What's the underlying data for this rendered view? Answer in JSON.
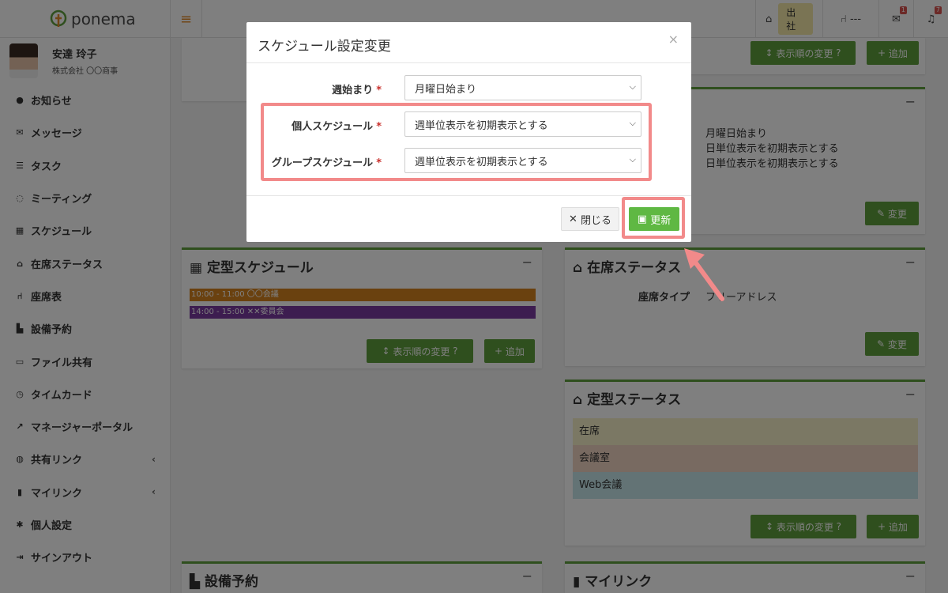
{
  "app": {
    "name": "ponema"
  },
  "header": {
    "status_label": "出社",
    "seat_label": "---",
    "message_count": "1",
    "notification_count": "7"
  },
  "user": {
    "name": "安達 玲子",
    "company": "株式会社 〇〇商事"
  },
  "sidebar": {
    "items": [
      {
        "label": "お知らせ",
        "icon": "info-icon"
      },
      {
        "label": "メッセージ",
        "icon": "envelope-icon"
      },
      {
        "label": "タスク",
        "icon": "list-icon"
      },
      {
        "label": "ミーティング",
        "icon": "chat-icon"
      },
      {
        "label": "スケジュール",
        "icon": "calendar-icon"
      },
      {
        "label": "在席ステータス",
        "icon": "desk-user-icon"
      },
      {
        "label": "座席表",
        "icon": "seat-icon"
      },
      {
        "label": "設備予約",
        "icon": "door-icon"
      },
      {
        "label": "ファイル共有",
        "icon": "folder-icon"
      },
      {
        "label": "タイムカード",
        "icon": "clock-icon"
      },
      {
        "label": "マネージャーポータル",
        "icon": "chart-icon"
      },
      {
        "label": "共有リンク",
        "icon": "globe-icon"
      },
      {
        "label": "マイリンク",
        "icon": "bookmark-icon"
      },
      {
        "label": "個人設定",
        "icon": "gear-icon"
      },
      {
        "label": "サインアウト",
        "icon": "signout-icon"
      }
    ]
  },
  "panels": {
    "top_right": {
      "order_label": "表示順の変更",
      "add_label": "追加"
    },
    "schedule_settings": {
      "values": [
        "月曜日始まり",
        "日単位表示を初期表示とする",
        "日単位表示を初期表示とする"
      ],
      "change_label": "変更"
    },
    "fixed_schedule": {
      "title": "定型スケジュール",
      "events": [
        {
          "label": "10:00 - 11:00 〇〇会議",
          "color": "#d4821f"
        },
        {
          "label": "14:00 - 15:00 ✕✕委員会",
          "color": "#7a3aa0"
        }
      ],
      "order_label": "表示順の変更",
      "add_label": "追加"
    },
    "presence": {
      "title": "在席ステータス",
      "seat_type_label": "座席タイプ",
      "seat_type_value": "フリーアドレス",
      "change_label": "変更"
    },
    "fixed_status": {
      "title": "定型ステータス",
      "items": [
        {
          "label": "在席",
          "color": "#f6f1c8"
        },
        {
          "label": "会議室",
          "color": "#f0d4c2"
        },
        {
          "label": "Web会議",
          "color": "#c6e7ea"
        }
      ],
      "order_label": "表示順の変更",
      "add_label": "追加"
    },
    "facility": {
      "title": "設備予約"
    },
    "mylink": {
      "title": "マイリンク"
    }
  },
  "modal": {
    "title": "スケジュール設定変更",
    "close_symbol": "×",
    "fields": [
      {
        "label": "週始まり",
        "value": "月曜日始まり"
      },
      {
        "label": "個人スケジュール",
        "value": "週単位表示を初期表示とする"
      },
      {
        "label": "グループスケジュール",
        "value": "週単位表示を初期表示とする"
      }
    ],
    "close_label": "閉じる",
    "save_label": "更新",
    "required_mark": "*"
  },
  "colors": {
    "accent": "#5f9e3d",
    "save": "#5fb843",
    "highlight": "#f28a8a"
  }
}
